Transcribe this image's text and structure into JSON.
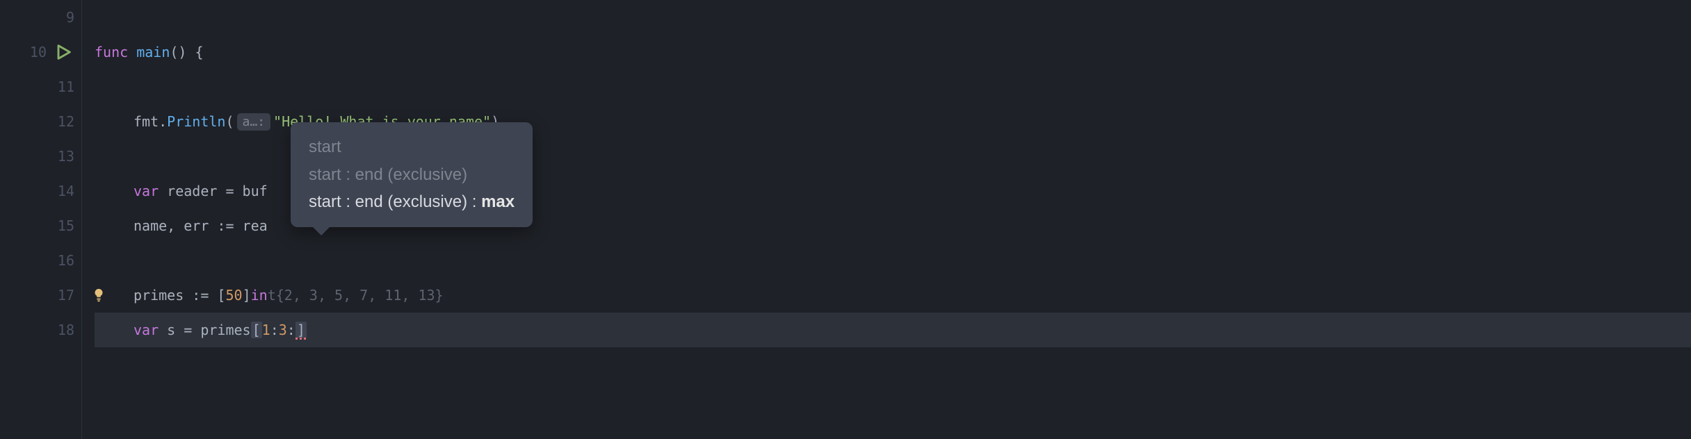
{
  "gutter": {
    "lines": [
      "9",
      "10",
      "11",
      "12",
      "13",
      "14",
      "15",
      "16",
      "17",
      "18"
    ],
    "run_icon_line": "10",
    "bulb_icon_line": "17",
    "current_line": "18"
  },
  "code": {
    "line10": {
      "func_kw": "func",
      "name": "main",
      "parens": "()",
      "brace": " {"
    },
    "line12": {
      "pkg": "fmt",
      "dot": ".",
      "fn": "Println",
      "open": "(",
      "hint": "a…:",
      "string": "\"Hello! What is your name\"",
      "close": ")"
    },
    "line14": {
      "var_kw": "var",
      "ident": " reader ",
      "eq": "= ",
      "rhs": "buf"
    },
    "line15": {
      "lhs": "name, err ",
      "op": ":= ",
      "rhs": "rea"
    },
    "line17": {
      "ident": "primes ",
      "op": ":= ",
      "open_bracket": "[",
      "size": "50",
      "close_bracket": "]",
      "type": "in",
      "hidden_tail": "t{2, 3, 5, 7, 11, 13}"
    },
    "line18": {
      "var_kw": "var",
      "ident": " s ",
      "eq": "= ",
      "target": "primes",
      "open": "[",
      "idx1": "1",
      "colon1": ":",
      "idx2": "3",
      "colon2": ":",
      "close": "]"
    }
  },
  "tooltip": {
    "rows": [
      {
        "text_plain": "start"
      },
      {
        "text_plain": "start : end (exclusive)"
      },
      {
        "prefix": "start : end (exclusive) : ",
        "bold": "max",
        "active": true
      }
    ]
  }
}
